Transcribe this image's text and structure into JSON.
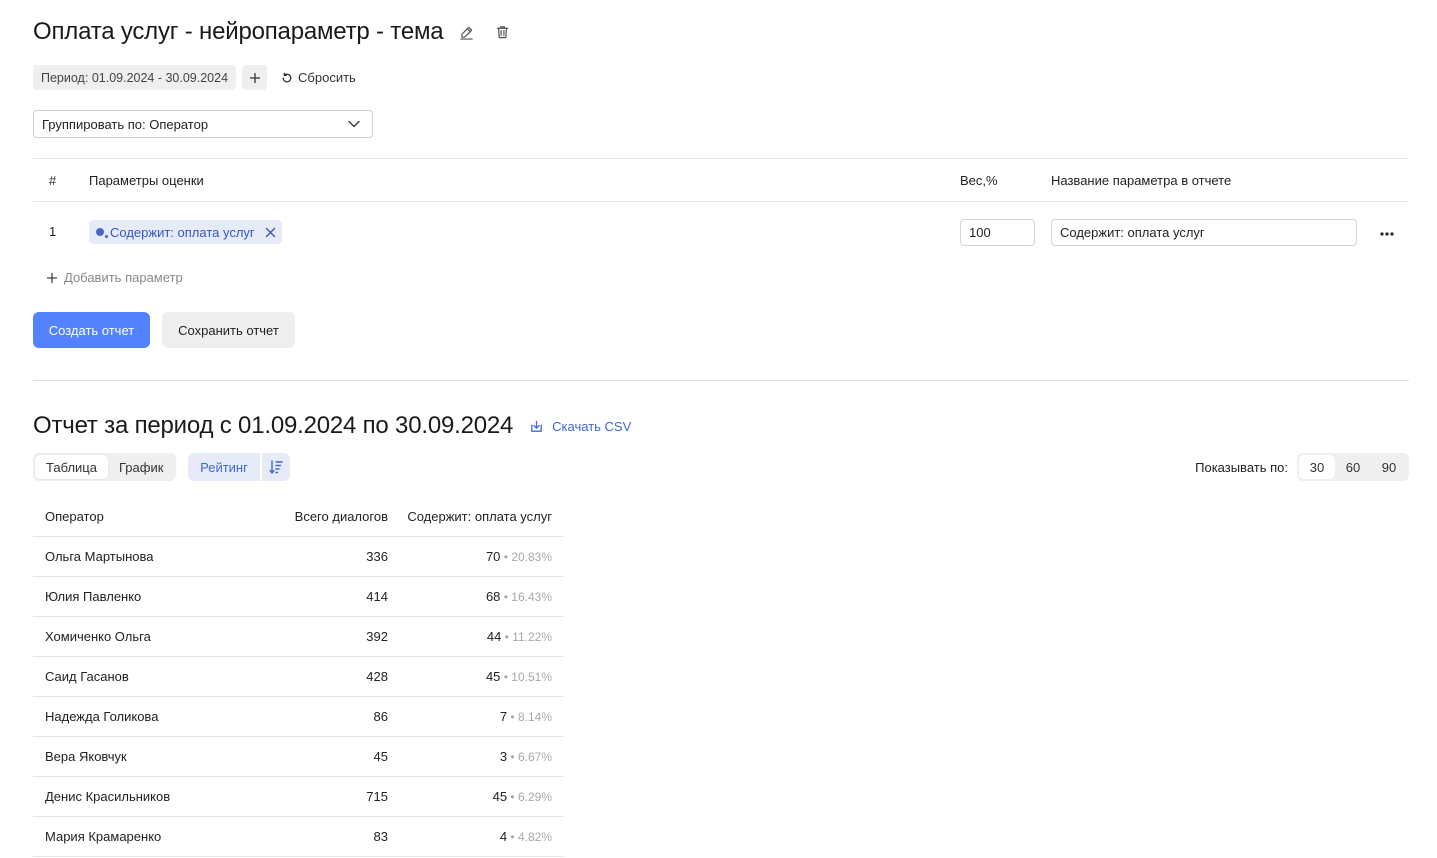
{
  "header": {
    "title": "Оплата услуг - нейропараметр - тема"
  },
  "filters": {
    "period_label": "Период:",
    "period_value": "01.09.2024 - 30.09.2024",
    "reset_label": "Сбросить"
  },
  "grouping": {
    "label": "Группировать по: Оператор"
  },
  "params_table": {
    "columns": {
      "num": "#",
      "params": "Параметры оценки",
      "weight": "Вес,%",
      "name": "Название параметра в отчете"
    },
    "rows": [
      {
        "num": "1",
        "tag_label": "Содержит: оплата услуг",
        "weight": "100",
        "report_name": "Содержит: оплата услуг"
      }
    ],
    "add_label": "Добавить параметр"
  },
  "actions": {
    "create_label": "Создать отчет",
    "save_label": "Сохранить отчет"
  },
  "report": {
    "title": "Отчет за период с 01.09.2024 по 30.09.2024",
    "csv_label": "Скачать CSV",
    "tabs": [
      "Таблица",
      "График"
    ],
    "active_tab": "Таблица",
    "rating_label": "Рейтинг",
    "page_size_label": "Показывать по:",
    "page_sizes": [
      "30",
      "60",
      "90"
    ],
    "active_page_size": "30",
    "columns": {
      "operator": "Оператор",
      "total": "Всего диалогов",
      "param": "Содержит: оплата услуг"
    },
    "rows": [
      {
        "operator": "Ольга Мартынова",
        "total": "336",
        "count": "70",
        "pct": "20.83%"
      },
      {
        "operator": "Юлия Павленко",
        "total": "414",
        "count": "68",
        "pct": "16.43%"
      },
      {
        "operator": "Хомиченко Ольга",
        "total": "392",
        "count": "44",
        "pct": "11.22%"
      },
      {
        "operator": "Саид Гасанов",
        "total": "428",
        "count": "45",
        "pct": "10.51%"
      },
      {
        "operator": "Надежда Голикова",
        "total": "86",
        "count": "7",
        "pct": "8.14%"
      },
      {
        "operator": "Вера Яковчук",
        "total": "45",
        "count": "3",
        "pct": "6.67%"
      },
      {
        "operator": "Денис Красильников",
        "total": "715",
        "count": "45",
        "pct": "6.29%"
      },
      {
        "operator": "Мария Крамаренко",
        "total": "83",
        "count": "4",
        "pct": "4.82%"
      }
    ]
  },
  "icons": {
    "edit": "pencil-icon",
    "delete": "trash-icon",
    "add": "plus-icon",
    "reset": "refresh-icon",
    "dropdown": "chevron-down-icon",
    "tag": "neuro-dot-icon",
    "close": "close-icon",
    "more": "more-horizontal-icon",
    "download": "download-icon",
    "sort": "sort-desc-icon"
  },
  "colors": {
    "primary": "#5282ff",
    "link": "#3f68d8",
    "tag_bg": "#e6ebf7",
    "muted": "#a8a8a8"
  }
}
